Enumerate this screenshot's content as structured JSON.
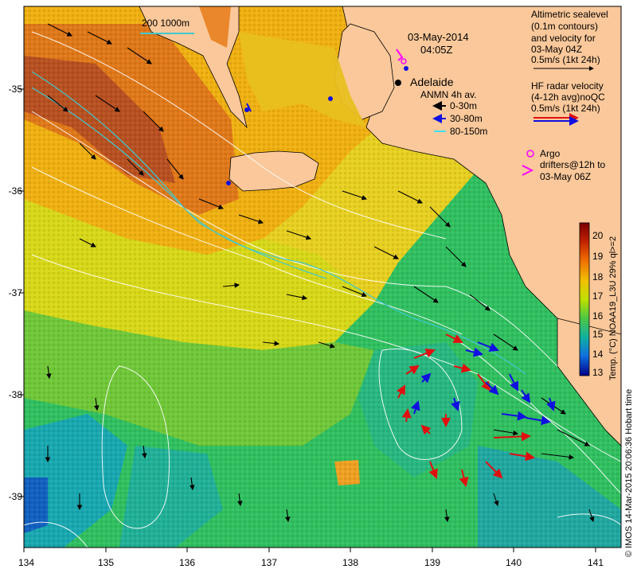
{
  "map": {
    "title_date": "03-May-2014",
    "title_time": "04:05Z",
    "city": "Adelaide",
    "scale_bar_label": "200  1000m",
    "x_ticks": [
      "134",
      "135",
      "136",
      "137",
      "138",
      "139",
      "140",
      "141"
    ],
    "y_ticks": [
      "-35",
      "-36",
      "-37",
      "-38",
      "-39"
    ],
    "x_range": [
      134,
      141.3
    ],
    "y_range": [
      -39.5,
      -34.3
    ]
  },
  "legend": {
    "altimetric_lines": [
      "Altimetric sealevel",
      "(0.1m contours)",
      "and velocity for",
      "03-May 04Z",
      "0.5m/s (1kt 24h)"
    ],
    "hf_lines": [
      "HF radar velocity",
      "(4-12h avg)noQC",
      "0.5m/s (1kt 24h)"
    ],
    "anmn_title": "ANMN 4h av.",
    "anmn_items": [
      {
        "label": "0-30m",
        "color": "#000000"
      },
      {
        "label": "30-80m",
        "color": "#1010e0"
      },
      {
        "label": "80-150m",
        "color": "#40e0f0"
      }
    ],
    "argo_lines": [
      "Argo",
      "drifters@12h to",
      "03-May 06Z"
    ]
  },
  "colorbar": {
    "label": "Temp. (°C) NOAA19_L3U 29% ql>=2",
    "ticks": [
      "20",
      "19",
      "18",
      "17",
      "16",
      "15",
      "14",
      "13"
    ],
    "colors": [
      "#7a0000",
      "#c01800",
      "#f06000",
      "#f0a000",
      "#f0e000",
      "#b0e000",
      "#50c840",
      "#10b080",
      "#10a0c0",
      "#1070e0",
      "#1030c0",
      "#000088"
    ]
  },
  "credit": "© IMOS 14-Mar-2015 20:06:36 Hobart time",
  "colors": {
    "land": "#fac89a",
    "ocean_warm": "#f0c020",
    "ocean_cool": "#30c060",
    "argo": "#ff00ff",
    "hf_radar": "#e01010"
  }
}
